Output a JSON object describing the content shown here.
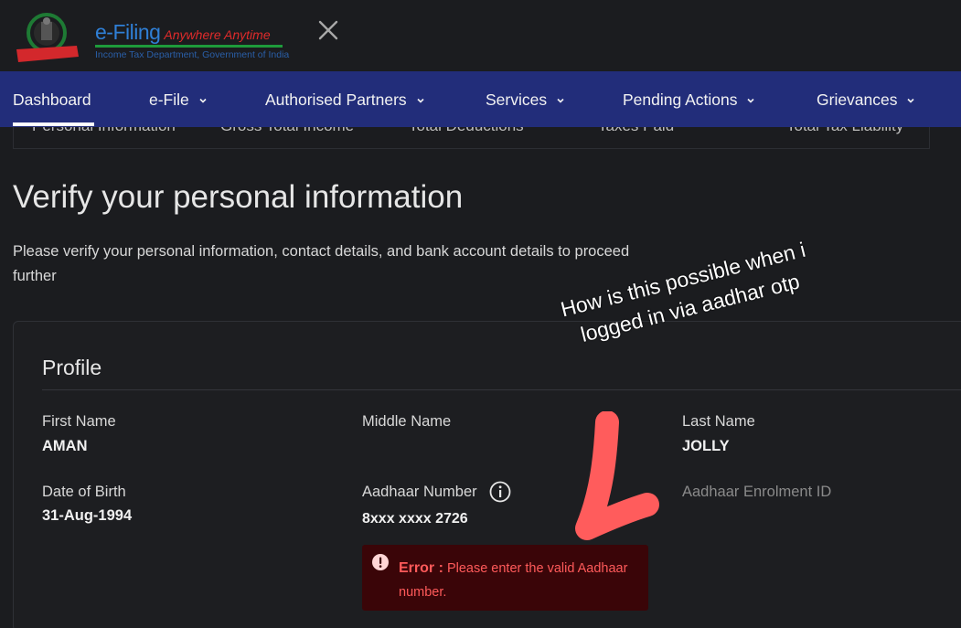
{
  "header": {
    "brand_main": "e-Filing",
    "brand_tagline": "Anywhere Anytime",
    "brand_sub": "Income Tax Department, Government of India",
    "emblem_text": "INCOME TAX DEPARTMENT"
  },
  "nav": {
    "items": [
      {
        "label": "Dashboard",
        "has_menu": false
      },
      {
        "label": "e-File",
        "has_menu": true
      },
      {
        "label": "Authorised Partners",
        "has_menu": true
      },
      {
        "label": "Services",
        "has_menu": true
      },
      {
        "label": "Pending Actions",
        "has_menu": true
      },
      {
        "label": "Grievances",
        "has_menu": true
      }
    ],
    "active": "Dashboard"
  },
  "steps": [
    "Personal Information",
    "Gross Total Income",
    "Total Deductions",
    "Taxes Paid",
    "Total Tax Liability"
  ],
  "page": {
    "title": "Verify your personal information",
    "description": "Please verify your personal information, contact details, and bank account details to proceed further"
  },
  "profile": {
    "title": "Profile",
    "first_name_label": "First Name",
    "first_name_value": "AMAN",
    "middle_name_label": "Middle Name",
    "middle_name_value": "",
    "last_name_label": "Last Name",
    "last_name_value": "JOLLY",
    "dob_label": "Date of Birth",
    "dob_value": "31-Aug-1994",
    "aadhaar_label": "Aadhaar Number",
    "aadhaar_value": "8xxx xxxx 2726",
    "enrolment_label": "Aadhaar Enrolment ID",
    "error_prefix": "Error :",
    "error_message": "Please enter the valid Aadhaar number."
  },
  "annotation": {
    "text": "How is this possible when i logged in via aadhar otp"
  },
  "colors": {
    "nav_bg": "#222d7a",
    "error_bg": "#3a0508",
    "error_text": "#ff5a5a",
    "annotation_arrow": "#ff5c5c"
  }
}
